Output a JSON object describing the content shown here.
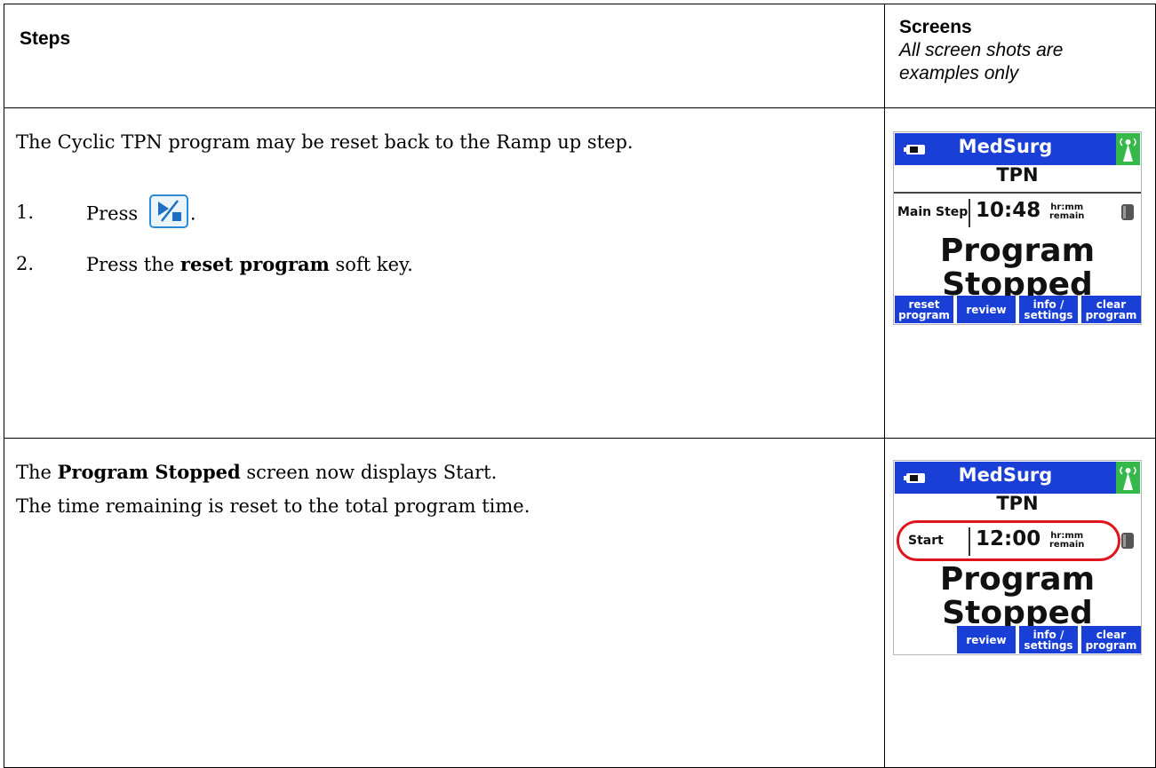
{
  "header": {
    "steps": "Steps",
    "screens_title": "Screens",
    "screens_subtitle_1": "All screen shots are",
    "screens_subtitle_2": "examples only"
  },
  "row1": {
    "intro": "The Cyclic TPN program may be reset back to the Ramp up step.",
    "step1_num": "1.",
    "step1_text": "Press",
    "step1_end": ".",
    "step2_num": "2.",
    "step2_pre": "Press the ",
    "step2_bold": "reset program",
    "step2_post": " soft key.",
    "screen": {
      "title": "MedSurg",
      "subtitle": "TPN",
      "step_label": "Main Step",
      "time": "10:48",
      "unit1": "hr:mm",
      "unit2": "remain",
      "big1": "Program",
      "big2": "Stopped",
      "keys": [
        {
          "l1": "reset",
          "l2": "program"
        },
        {
          "l1": "review",
          "l2": ""
        },
        {
          "l1": "info /",
          "l2": "settings"
        },
        {
          "l1": "clear",
          "l2": "program"
        }
      ]
    }
  },
  "row2": {
    "line1_pre": "The ",
    "line1_bold": "Program Stopped",
    "line1_post": " screen now displays Start.",
    "line2": "The time remaining is reset to the total program time.",
    "screen": {
      "title": "MedSurg",
      "subtitle": "TPN",
      "step_label": "Start",
      "time": "12:00",
      "unit1": "hr:mm",
      "unit2": "remain",
      "big1": "Program",
      "big2": "Stopped",
      "keys": [
        {
          "l1": "review",
          "l2": ""
        },
        {
          "l1": "info /",
          "l2": "settings"
        },
        {
          "l1": "clear",
          "l2": "program"
        }
      ]
    }
  },
  "colors": {
    "screen_blue": "#1a3fd6",
    "wifi_green": "#35b84a",
    "highlight_red": "#e0141c",
    "key_icon_blue": "#2b8bd6"
  },
  "icons": [
    "play-stop-key-icon",
    "battery-icon",
    "wireless-icon",
    "container-icon"
  ]
}
